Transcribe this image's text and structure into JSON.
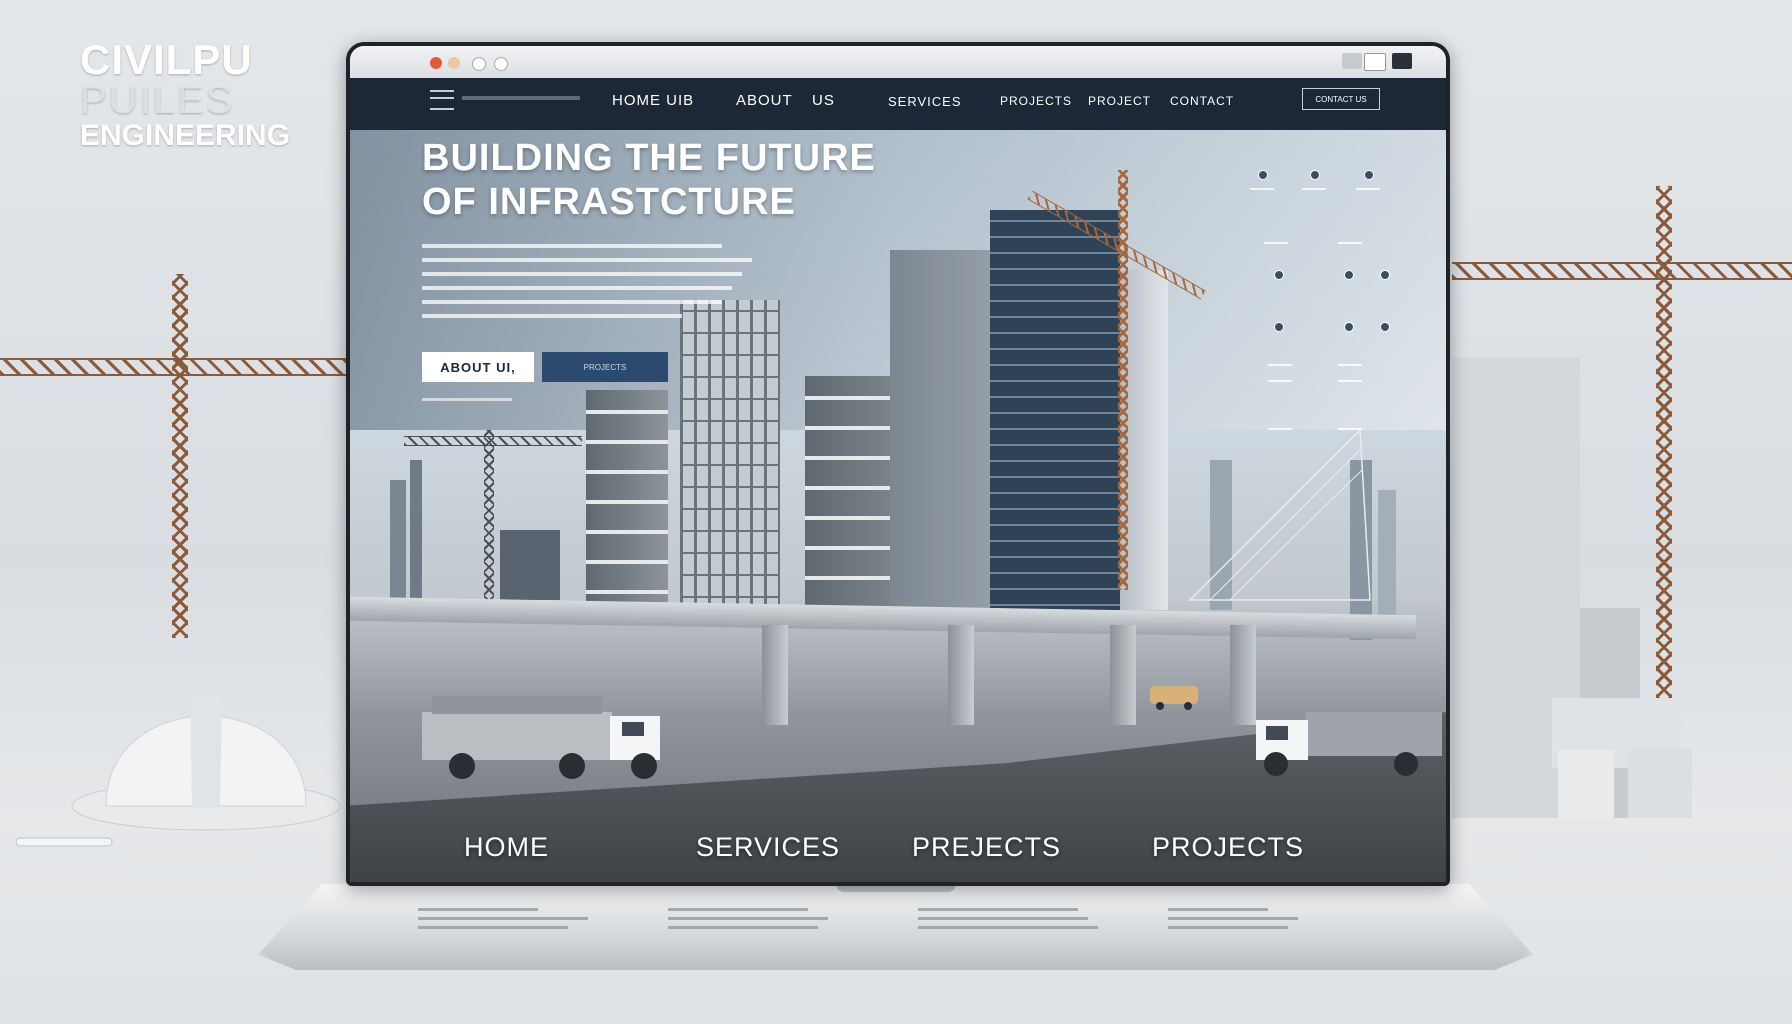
{
  "brand": {
    "line1": "CIVILPU",
    "line2": "PUILES",
    "line3": "ENGINEERING"
  },
  "nav": {
    "items": [
      "HOME UIB",
      "ABOUT",
      "US",
      "SERVICES",
      "PROJECTS",
      "PROJECT",
      "CONTACT"
    ],
    "cta_label": "CONTACT US"
  },
  "hero": {
    "title_line1": "BUILDING THE FUTURE",
    "title_line2": "OF   INFRASTCTURE",
    "button_primary": "ABOUT UI,",
    "button_secondary": "PROJECTS"
  },
  "bottom_nav": [
    "HOME",
    "SERVICES",
    "PREJECTS",
    "PROJECTS"
  ],
  "colors": {
    "nav_bg": "#1c2838",
    "accent": "#2b4a6d",
    "crane": "#a5683f",
    "dot_red": "#e25c3a"
  }
}
